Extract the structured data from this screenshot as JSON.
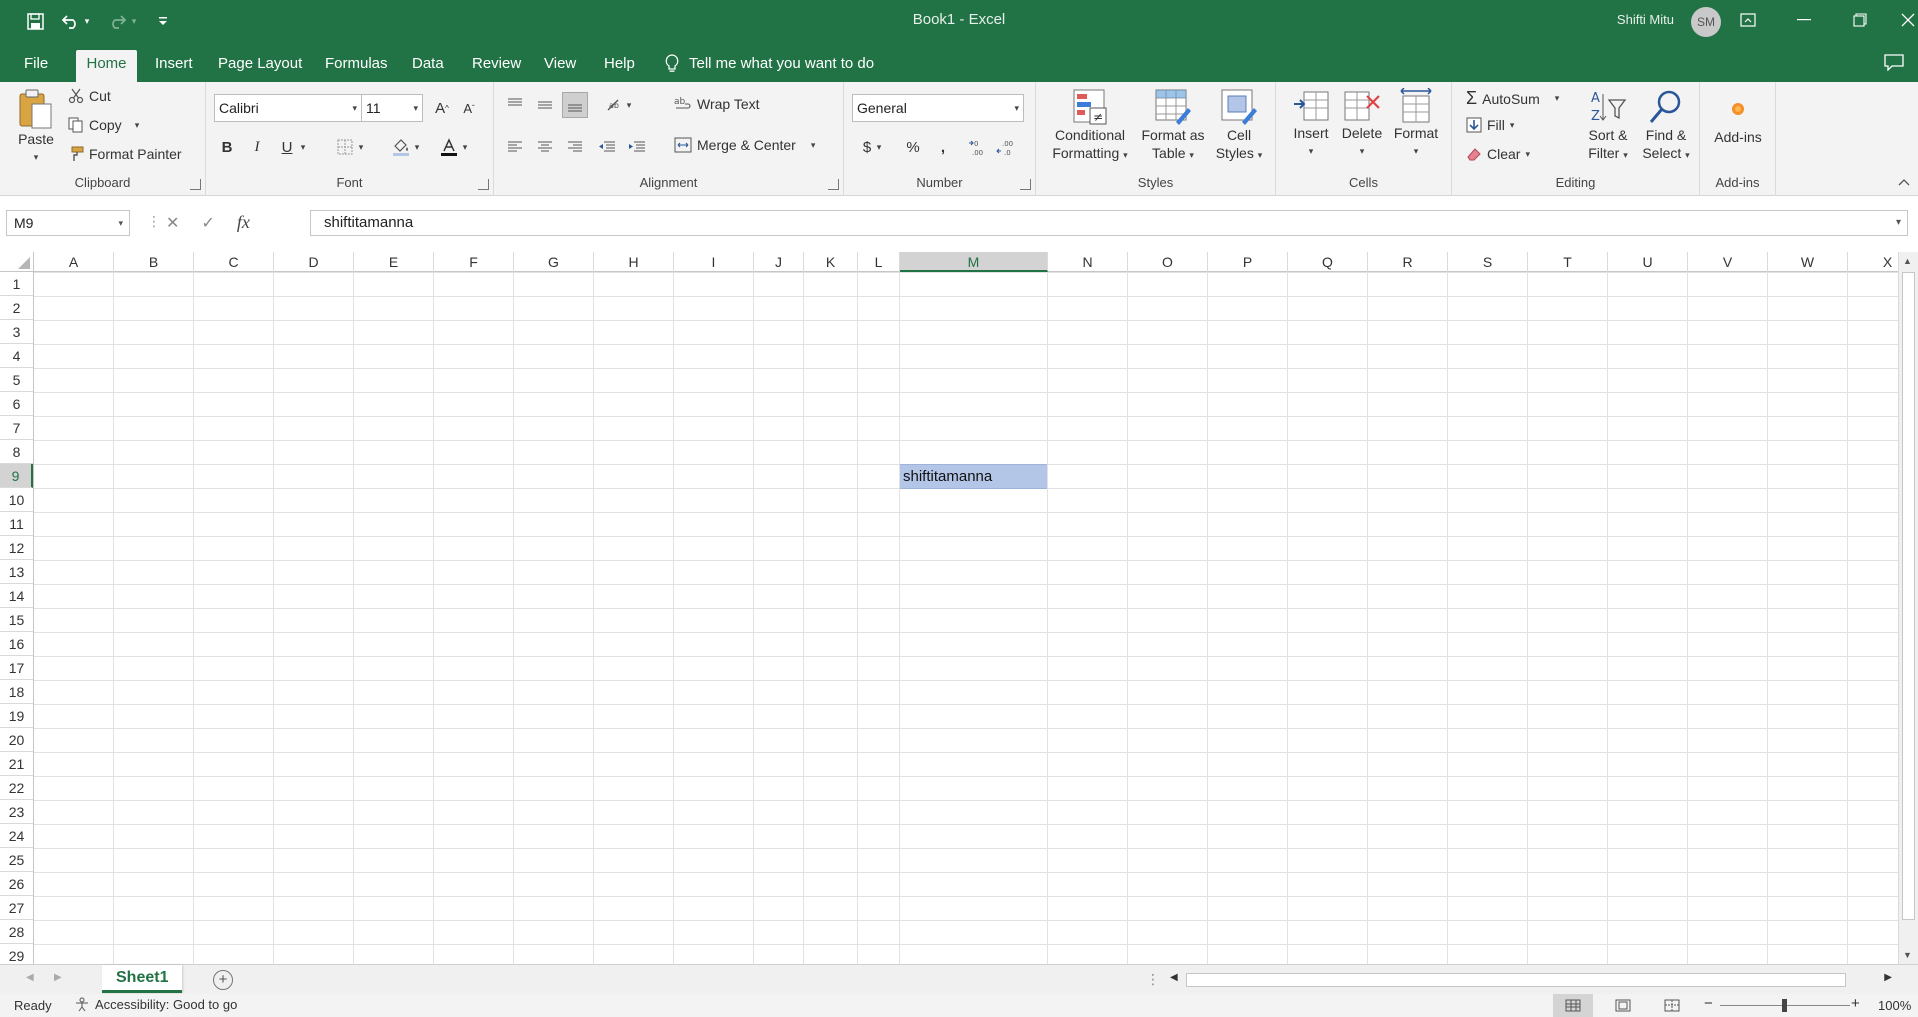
{
  "window": {
    "title": "Book1  -  Excel",
    "user_name": "Shifti Mitu",
    "user_initials": "SM"
  },
  "colors": {
    "brand": "#217346",
    "selection": "#b4c6e7"
  },
  "tabs": [
    {
      "label": "File"
    },
    {
      "label": "Home"
    },
    {
      "label": "Insert"
    },
    {
      "label": "Page Layout"
    },
    {
      "label": "Formulas"
    },
    {
      "label": "Data"
    },
    {
      "label": "Review"
    },
    {
      "label": "View"
    },
    {
      "label": "Help"
    }
  ],
  "active_tab": "Home",
  "tell_me": "Tell me what you want to do",
  "ribbon": {
    "clipboard": {
      "label": "Clipboard",
      "paste": "Paste",
      "cut": "Cut",
      "copy": "Copy",
      "format_painter": "Format Painter"
    },
    "font": {
      "label": "Font",
      "name": "Calibri",
      "size": "11",
      "bold": "B",
      "italic": "I",
      "underline": "U",
      "grow": "A",
      "shrink": "A"
    },
    "alignment": {
      "label": "Alignment",
      "wrap_text": "Wrap Text",
      "merge_center": "Merge & Center"
    },
    "number": {
      "label": "Number",
      "format": "General",
      "currency": "$",
      "percent": "%",
      "comma": ","
    },
    "styles": {
      "label": "Styles",
      "conditional_1": "Conditional",
      "conditional_2": "Formatting",
      "format_table_1": "Format as",
      "format_table_2": "Table",
      "cell_styles_1": "Cell",
      "cell_styles_2": "Styles"
    },
    "cells": {
      "label": "Cells",
      "insert": "Insert",
      "delete": "Delete",
      "format": "Format"
    },
    "editing": {
      "label": "Editing",
      "autosum": "AutoSum",
      "fill": "Fill",
      "clear": "Clear",
      "sort_1": "Sort &",
      "sort_2": "Filter",
      "find_1": "Find &",
      "find_2": "Select"
    },
    "addins": {
      "label": "Add-ins",
      "button": "Add-ins"
    }
  },
  "formula_bar": {
    "name_box": "M9",
    "fx": "fx",
    "content": "shiftitamanna"
  },
  "grid": {
    "columns": [
      "A",
      "B",
      "C",
      "D",
      "E",
      "F",
      "G",
      "H",
      "I",
      "J",
      "K",
      "L",
      "M",
      "N",
      "O",
      "P",
      "Q",
      "R",
      "S",
      "T",
      "U",
      "V",
      "W",
      "X"
    ],
    "rows": [
      "1",
      "2",
      "3",
      "4",
      "5",
      "6",
      "7",
      "8",
      "9",
      "10",
      "11",
      "12",
      "13",
      "14",
      "15",
      "16",
      "17",
      "18",
      "19",
      "20",
      "21",
      "22",
      "23",
      "24",
      "25",
      "26",
      "27",
      "28",
      "29"
    ],
    "selected_column": "M",
    "selected_row": "9",
    "active_cell_value": "shiftitamanna"
  },
  "sheets": [
    {
      "label": "Sheet1",
      "active": true
    }
  ],
  "status": {
    "ready": "Ready",
    "accessibility": "Accessibility: Good to go",
    "zoom": "100%",
    "zoom_minus": "−",
    "zoom_plus": "+"
  }
}
